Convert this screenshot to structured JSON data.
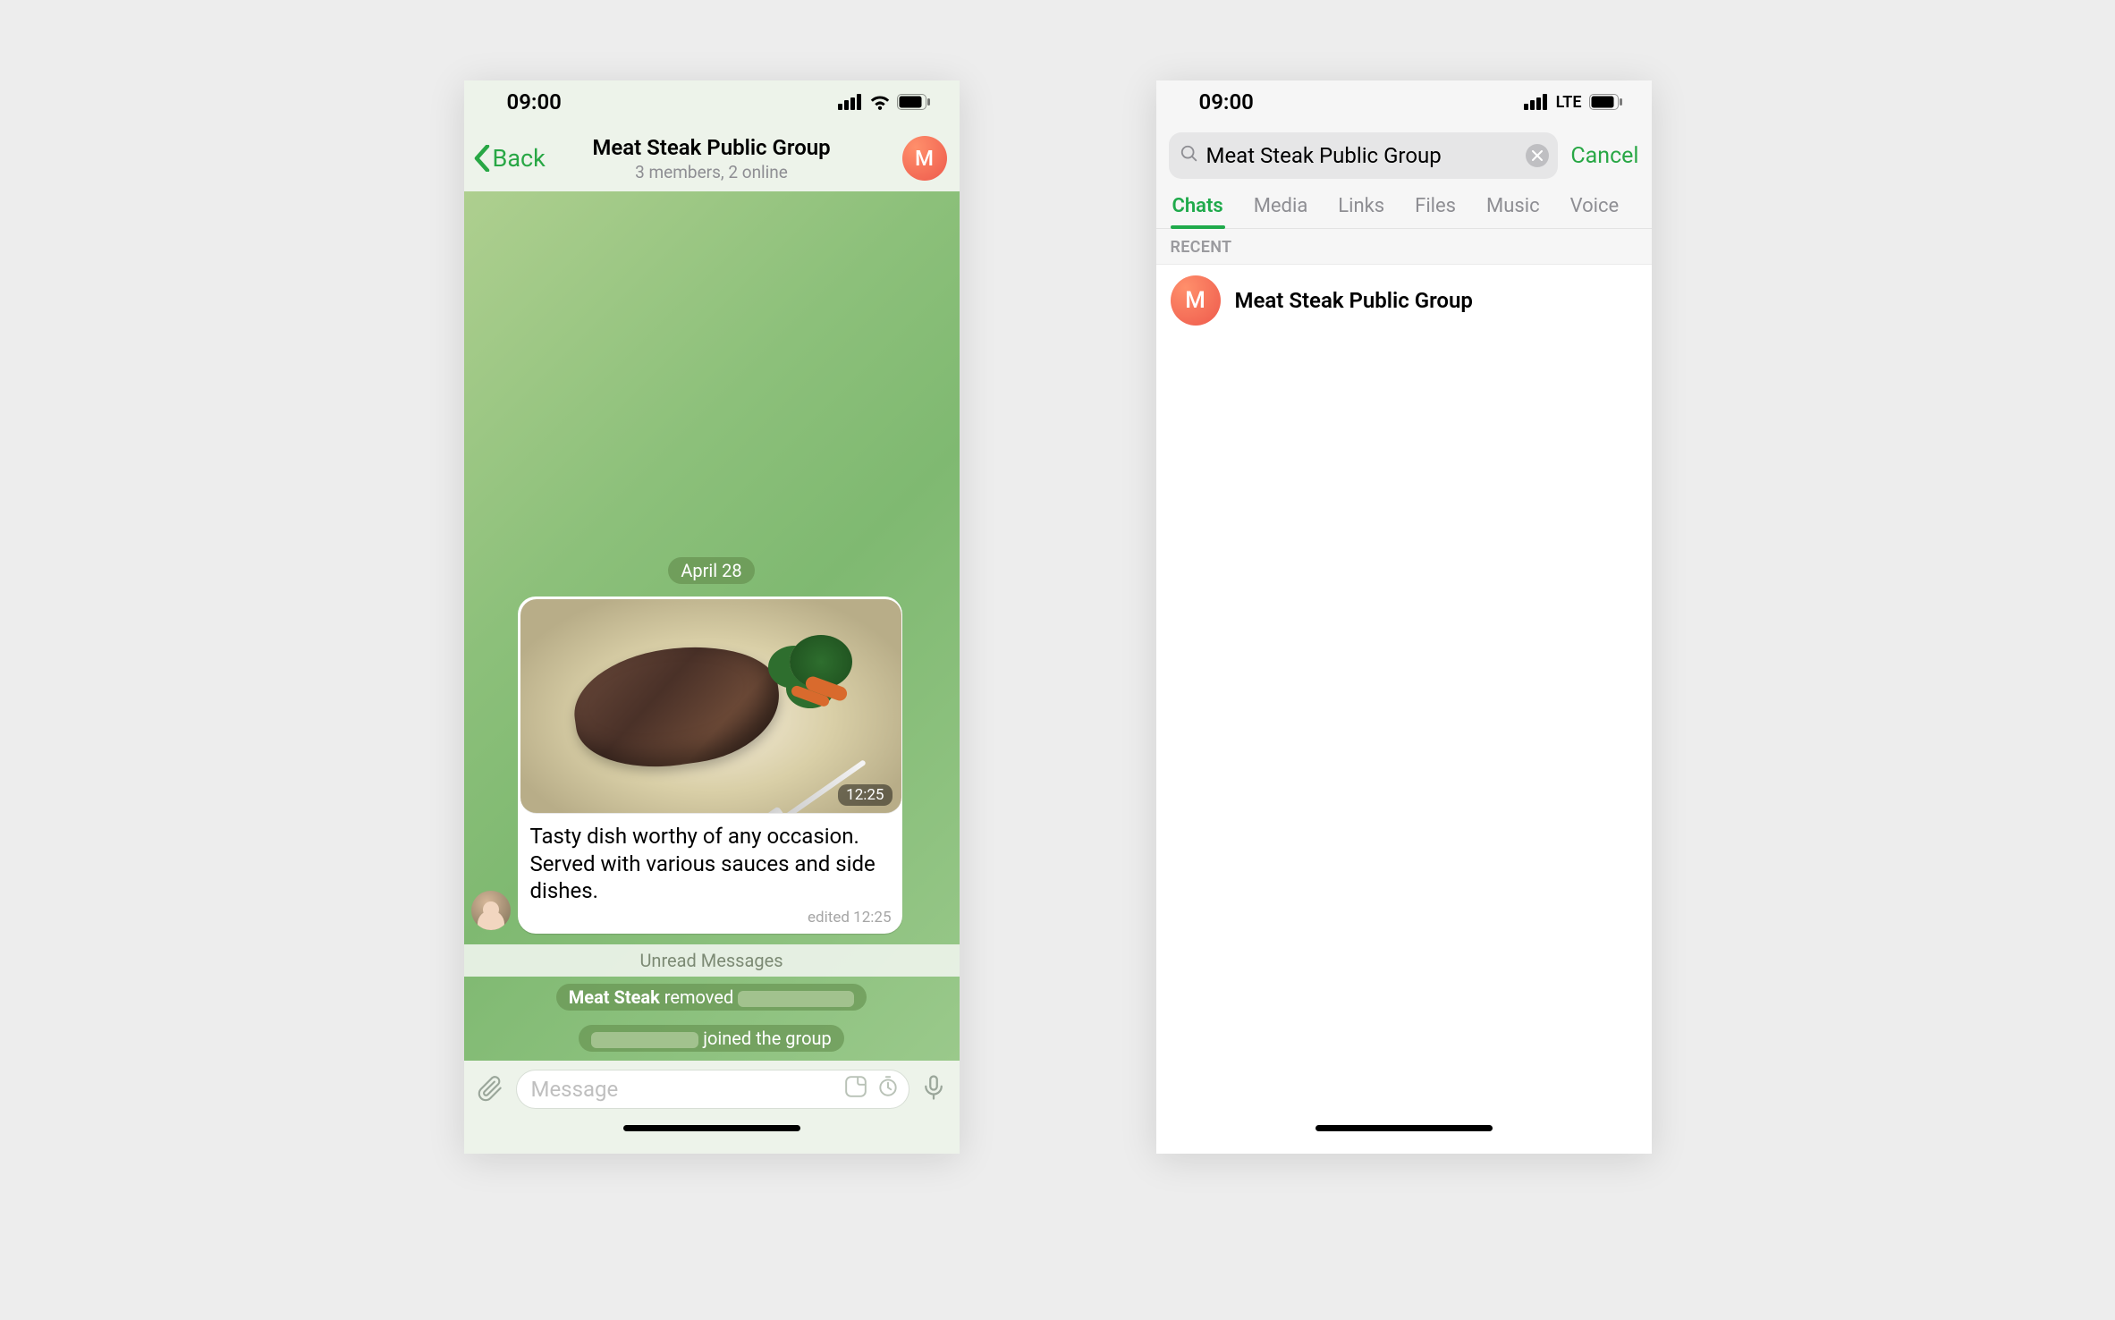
{
  "status": {
    "time": "09:00",
    "network": "LTE"
  },
  "phoneA": {
    "back": "Back",
    "title": "Meat Steak Public Group",
    "subtitle": "3 members, 2 online",
    "avatar_letter": "M",
    "date_pill": "April 28",
    "img_time": "12:25",
    "message_text": "Tasty dish worthy of any occasion. Served with various sauces and side dishes.",
    "edited": "edited 12:25",
    "unread_label": "Unread Messages",
    "sys1_bold": "Meat Steak",
    "sys1_tail": " removed ",
    "sys2_tail": " joined the group",
    "input_placeholder": "Message"
  },
  "phoneB": {
    "search_value": "Meat Steak Public Group",
    "cancel": "Cancel",
    "tabs": [
      "Chats",
      "Media",
      "Links",
      "Files",
      "Music",
      "Voice"
    ],
    "recent_label": "RECENT",
    "result_avatar_letter": "M",
    "result_title": "Meat Steak Public Group"
  }
}
